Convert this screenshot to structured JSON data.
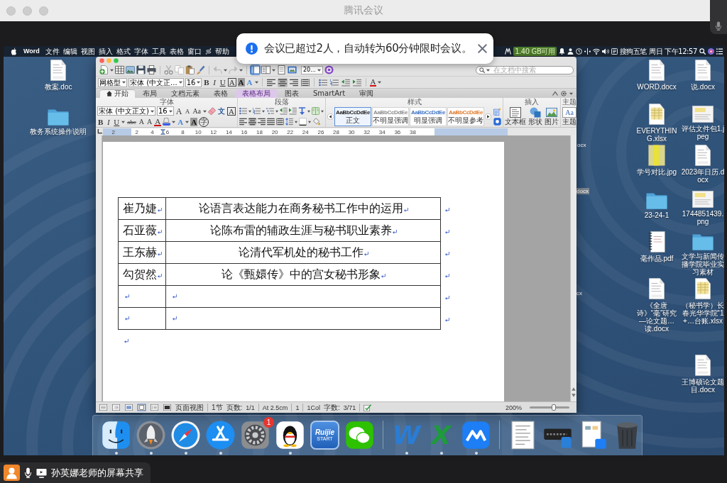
{
  "window": {
    "title": "腾讯会议"
  },
  "notification": {
    "message": "会议已超过2人，自动转为60分钟限时会议。"
  },
  "menu_bar": {
    "app": "Word",
    "items": [
      "文件",
      "编辑",
      "视图",
      "插入",
      "格式",
      "字体",
      "工具",
      "表格",
      "窗口",
      "帮助"
    ],
    "memory": "1.40 GB可用",
    "input_method": "搜狗五笔",
    "clock": "周日 下午12:57"
  },
  "desktop_icons": [
    {
      "label": "教案.doc",
      "kind": "doc"
    },
    {
      "label": "WORD.docx",
      "kind": "doc"
    },
    {
      "label": "说.docx",
      "kind": "doc"
    },
    {
      "label": "教务系统操作说明",
      "kind": "folder"
    },
    {
      "label": "EVERYTHING.xlsx",
      "kind": "sheet"
    },
    {
      "label": "评估文件包1.jpeg",
      "kind": "image"
    },
    {
      "label": "学号对比.jpg",
      "kind": "tall_image"
    },
    {
      "label": "2023年日历.docx",
      "kind": "doc"
    },
    {
      "label": "23-24-1",
      "kind": "folder"
    },
    {
      "label": "1744851439.png",
      "kind": "image"
    },
    {
      "label": "毫作品.pdf",
      "kind": "pdf"
    },
    {
      "label": "文学与新闻传播学院毕业实习素材",
      "kind": "folder"
    },
    {
      "label": "《全唐诗》“毫”研究—论文题…读.docx",
      "kind": "doc"
    },
    {
      "label": "（秘书学）长春光华学院“1+…台账.xlsx",
      "kind": "sheet"
    },
    {
      "label": "王博硕论文题目.docx",
      "kind": "doc"
    }
  ],
  "covered_icon_labels": [
    "ocx",
    "docx",
    "cx"
  ],
  "word": {
    "toolbar": {
      "sidebar_shown": true,
      "zoom": "20..."
    },
    "search": {
      "placeholder": "在文档中搜索"
    },
    "format_bar": {
      "table_style": "网格型",
      "font": "宋体 (中文正...",
      "size": "16",
      "letters": [
        {
          "text": "B",
          "kind": "bold"
        },
        {
          "text": "I",
          "kind": "italic"
        },
        {
          "text": "U",
          "kind": "underline"
        },
        {
          "text": "A",
          "kind": "boxed"
        },
        {
          "text": "A",
          "kind": "shaded"
        },
        {
          "text": "A",
          "kind": "effect"
        }
      ],
      "align_buttons": [
        {
          "selected": false
        },
        {
          "selected": true
        },
        {
          "selected": false
        },
        {
          "selected": false
        }
      ],
      "color_letter": {
        "text": "A",
        "kind": "color"
      }
    },
    "tabs": [
      {
        "label": "开始",
        "selected": true,
        "contextual": false
      },
      {
        "label": "布局",
        "selected": false,
        "contextual": false
      },
      {
        "label": "文档元素",
        "selected": false,
        "contextual": false
      },
      {
        "label": "表格",
        "selected": false,
        "contextual": false
      },
      {
        "label": "表格布局",
        "selected": false,
        "contextual": true
      },
      {
        "label": "图表",
        "selected": false,
        "contextual": false
      },
      {
        "label": "SmartArt",
        "selected": false,
        "contextual": false
      },
      {
        "label": "审阅",
        "selected": false,
        "contextual": false
      }
    ],
    "ribbon": {
      "font_group": {
        "title": "字体",
        "font": "宋体 (中文正文)",
        "size": "16",
        "row1": [
          {
            "text": "A",
            "kind": "grow"
          },
          {
            "text": "A",
            "kind": "shrink"
          },
          {
            "text": "Aa",
            "kind": "case"
          },
          {
            "text": "文",
            "kind": "phonetic"
          },
          {
            "text": "A",
            "kind": "boxed"
          }
        ],
        "row2": [
          {
            "text": "B",
            "kind": "bold"
          },
          {
            "text": "I",
            "kind": "italic"
          },
          {
            "text": "U",
            "kind": "underline"
          },
          {
            "text": "abc",
            "kind": "strike"
          },
          {
            "text": "A",
            "kind": "superscript"
          },
          {
            "text": "A",
            "kind": "subscript"
          },
          {
            "text": "A",
            "kind": "color"
          },
          {
            "text": "A",
            "kind": "effect"
          },
          {
            "text": "A",
            "kind": "shaded"
          },
          {
            "text": "字",
            "kind": "enclosed"
          }
        ]
      },
      "paragraph_group": {
        "title": "段落",
        "align_buttons": [
          {
            "selected": false
          },
          {
            "selected": true
          },
          {
            "selected": false
          },
          {
            "selected": false
          },
          {
            "selected": false
          }
        ]
      },
      "styles_group": {
        "title": "样式",
        "styles": [
          {
            "preview": "AaBbCcDdEe",
            "name": "正文",
            "selected": true,
            "color": "#1f1f1f"
          },
          {
            "preview": "AaBbCcDdEe",
            "name": "不明显强调",
            "selected": false,
            "color": "#8a8a8a"
          },
          {
            "preview": "AaBbCcDdEe",
            "name": "明显强调",
            "selected": false,
            "color": "#3f74c4"
          },
          {
            "preview": "AaBbCcDdEe",
            "name": "不明显参考",
            "selected": false,
            "color": "#e07a2a"
          }
        ]
      },
      "insert_group": {
        "title": "插入",
        "items": [
          "文本框",
          "形状",
          "图片"
        ]
      },
      "theme_group": {
        "title": "主题",
        "preview": "Aa",
        "label": "主题"
      }
    },
    "ruler": [
      "2",
      "2",
      "4",
      "6",
      "8",
      "10",
      "12",
      "14",
      "16",
      "18",
      "20",
      "22",
      "24",
      "26",
      "28",
      "30",
      "32",
      "34",
      "36",
      "38"
    ],
    "table": {
      "rows": [
        {
          "name": "崔乃婕",
          "title": "论语言表达能力在商务秘书工作中的运用",
          "blank": false
        },
        {
          "name": "石亚薇",
          "title": "论陈布雷的辅政生涯与秘书职业素养",
          "blank": false
        },
        {
          "name": "王东赫",
          "title": "论清代军机处的秘书工作",
          "blank": false
        },
        {
          "name": "勾贺然",
          "title": "论《甄嬛传》中的宫女秘书形象",
          "blank": false
        },
        {
          "blank": true
        },
        {
          "blank": true
        }
      ]
    },
    "status_bar": {
      "view_buttons": [
        {
          "selected": false
        },
        {
          "selected": false
        },
        {
          "selected": false
        },
        {
          "selected": true
        },
        {
          "selected": false
        },
        {
          "selected": false
        }
      ],
      "view": "页面视图",
      "section": "1节",
      "pages_label": "页数:",
      "pages": "1/1",
      "position": "At 2.5cm",
      "line": "1",
      "column": "1Col",
      "words_label": "字数:",
      "words": "3/71",
      "zoom": "200%",
      "zoom_slider": {
        "level": 0.6
      }
    }
  },
  "dock": {
    "apps": [
      {
        "kind": "finder",
        "running": true
      },
      {
        "kind": "rocket",
        "running": true
      },
      {
        "kind": "compass",
        "running": true
      },
      {
        "kind": "store",
        "running": true
      },
      {
        "kind": "gear",
        "running": false,
        "badge": "1"
      },
      {
        "kind": "penguin",
        "running": true
      },
      {
        "kind": "shield",
        "running": false,
        "logo": "Ruijie",
        "caption": "START"
      },
      {
        "kind": "chat",
        "running": false
      }
    ],
    "tools": [
      {
        "kind": "letter",
        "glyph": "W",
        "color": "#2b7cd3",
        "running": true
      },
      {
        "kind": "letter",
        "glyph": "X",
        "color": "#1f9a3c",
        "running": true
      },
      {
        "kind": "peaks",
        "running": true
      }
    ],
    "stacks": [
      {
        "kind": "document",
        "running": false
      },
      {
        "kind": "device",
        "running": false
      },
      {
        "kind": "file",
        "running": false
      },
      {
        "kind": "trash",
        "running": false
      }
    ]
  },
  "screen_share": {
    "label": "孙英娜老师的屏幕共享"
  }
}
